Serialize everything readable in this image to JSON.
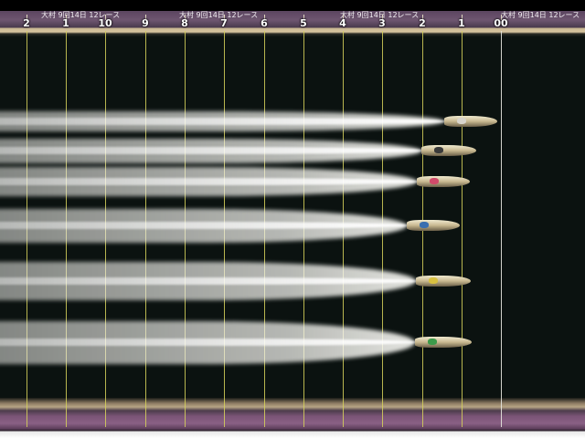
{
  "overlay": {
    "sponsor_text": "大村 9回14日 12レース",
    "markers": [
      {
        "label": "2",
        "style": "yellow"
      },
      {
        "label": "1",
        "style": "yellow"
      },
      {
        "label": "10",
        "style": "yellow"
      },
      {
        "label": "9",
        "style": "yellow"
      },
      {
        "label": "8",
        "style": "yellow"
      },
      {
        "label": "7",
        "style": "yellow"
      },
      {
        "label": "6",
        "style": "yellow"
      },
      {
        "label": "5",
        "style": "yellow"
      },
      {
        "label": "4",
        "style": "yellow"
      },
      {
        "label": "3",
        "style": "yellow"
      },
      {
        "label": "2",
        "style": "yellow"
      },
      {
        "label": "1",
        "style": "yellow"
      },
      {
        "label": "00",
        "style": "white"
      }
    ]
  },
  "boats": [
    {
      "name": "boat-1",
      "cockpit_color": "#d8d4cc"
    },
    {
      "name": "boat-2",
      "cockpit_color": "#3a3a3a"
    },
    {
      "name": "boat-3",
      "cockpit_color": "#d04a6a"
    },
    {
      "name": "boat-4",
      "cockpit_color": "#3a6fb0"
    },
    {
      "name": "boat-5",
      "cockpit_color": "#d8c040"
    },
    {
      "name": "boat-6",
      "cockpit_color": "#3c9a4a"
    }
  ],
  "colors": {
    "water": "#0b1210",
    "lane_line": "#d7d25a",
    "start_line": "#e8e8e0"
  }
}
